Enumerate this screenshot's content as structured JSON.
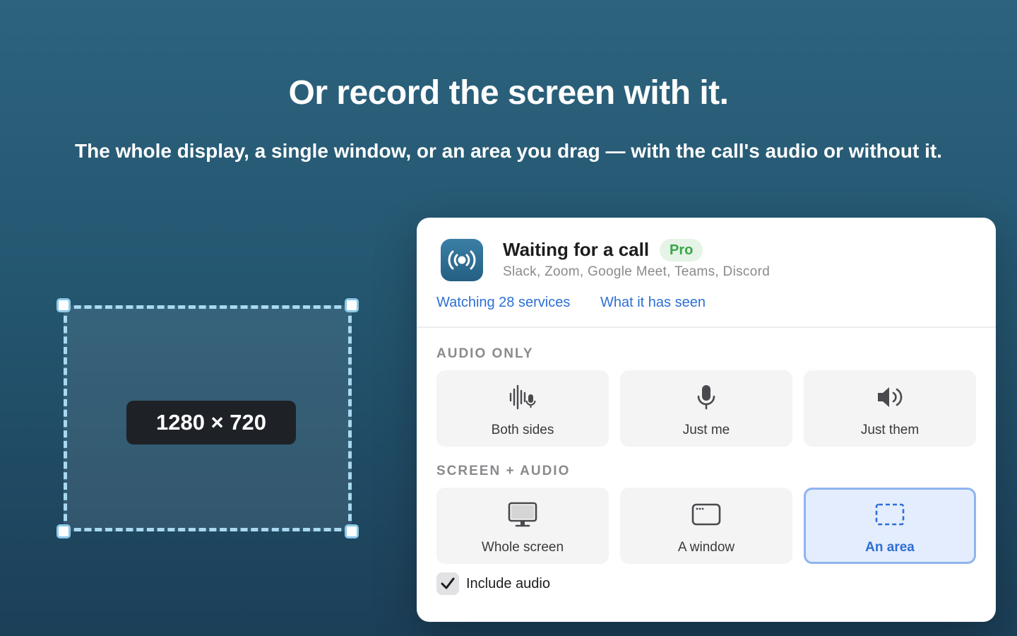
{
  "hero": {
    "headline": "Or record the screen with it.",
    "subline": "The whole display, a single window, or an area you drag — with the call's audio or without it."
  },
  "area_preview": {
    "dimensions": "1280 × 720"
  },
  "panel": {
    "title": "Waiting for a call",
    "badge": "Pro",
    "services": "Slack, Zoom, Google Meet, Teams, Discord",
    "links": {
      "watching": "Watching 28 services",
      "seen": "What it has seen"
    },
    "audio_only": {
      "label": "AUDIO ONLY",
      "options": [
        {
          "label": "Both sides",
          "icon": "waveform-mic-icon"
        },
        {
          "label": "Just me",
          "icon": "microphone-icon"
        },
        {
          "label": "Just them",
          "icon": "speaker-icon"
        }
      ]
    },
    "screen_audio": {
      "label": "SCREEN + AUDIO",
      "options": [
        {
          "label": "Whole screen",
          "icon": "monitor-icon"
        },
        {
          "label": "A window",
          "icon": "window-icon"
        },
        {
          "label": "An area",
          "icon": "dashed-rect-icon",
          "selected": true
        }
      ]
    },
    "include_audio": {
      "label": "Include audio",
      "checked": true
    }
  },
  "colors": {
    "accent": "#2c6fd4",
    "pro_green": "#3aa54a",
    "selection_border": "#a9d9f2"
  }
}
